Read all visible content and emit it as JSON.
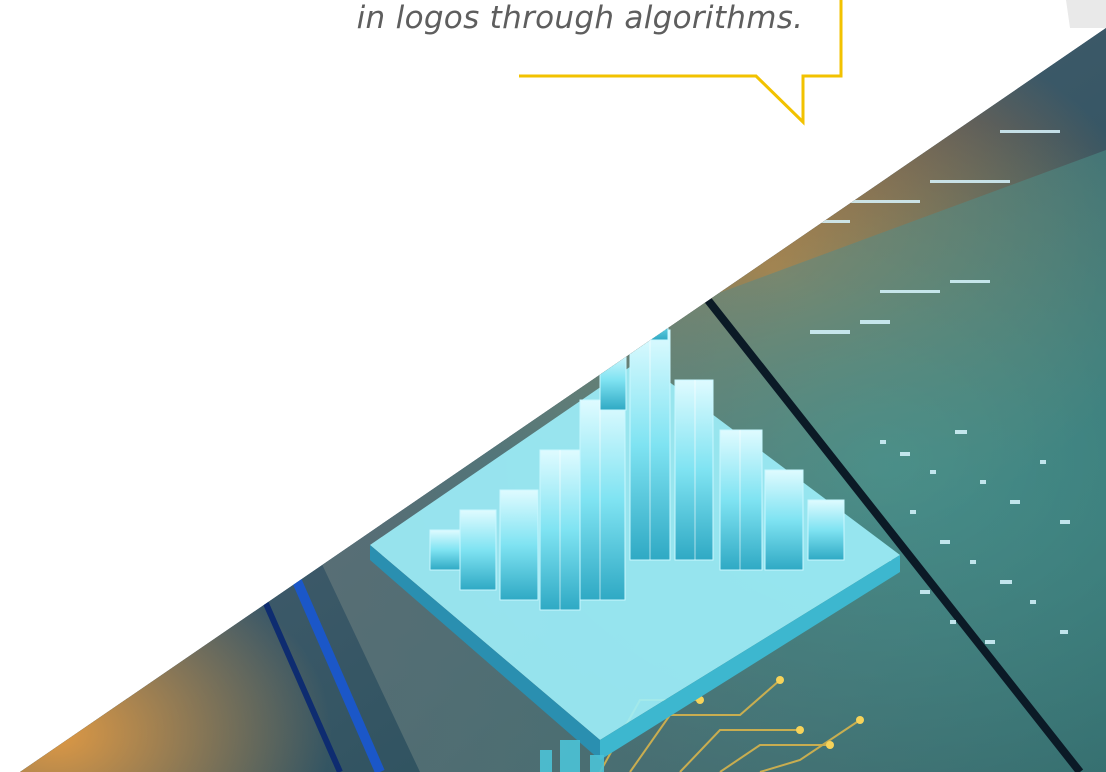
{
  "callout": {
    "text": "in logos through algorithms."
  },
  "colors": {
    "accent": "#f2c200",
    "callout_text": "#5e5e5e",
    "background": "#ffffff"
  },
  "image": {
    "icon": "isometric-glass-city-circuit-photo"
  }
}
